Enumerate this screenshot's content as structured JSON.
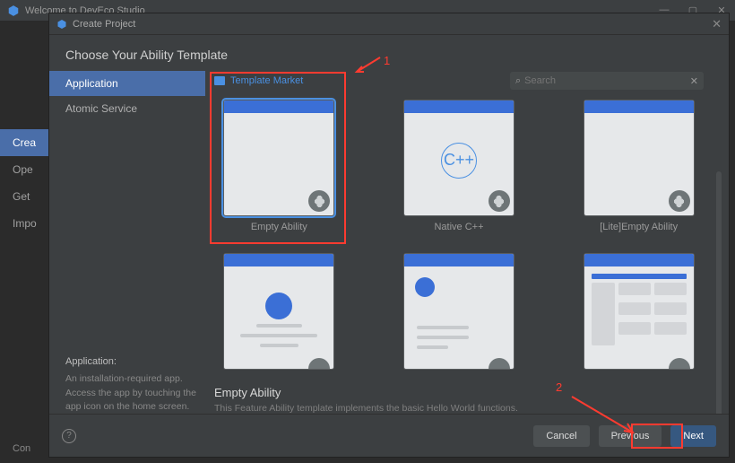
{
  "bg": {
    "title": "Welcome to DevEco Studio",
    "sidebar": [
      "Crea",
      "Ope",
      "Get",
      "Impo"
    ],
    "bottom": "Con"
  },
  "dialog": {
    "title": "Create Project",
    "heading": "Choose Your Ability Template",
    "tabs": [
      "Application",
      "Atomic Service"
    ],
    "market": "Template Market",
    "search_placeholder": "Search",
    "left_desc_title": "Application:",
    "left_desc_body": "An installation-required app. Access the app by touching the app icon on the home screen.",
    "templates_row1": [
      "Empty Ability",
      "Native C++",
      "[Lite]Empty Ability"
    ],
    "selected_title": "Empty Ability",
    "selected_desc": "This Feature Ability template implements the basic Hello World functions.",
    "buttons": {
      "cancel": "Cancel",
      "previous": "Previous",
      "next": "Next"
    }
  },
  "annotations": {
    "one": "1",
    "two": "2"
  }
}
